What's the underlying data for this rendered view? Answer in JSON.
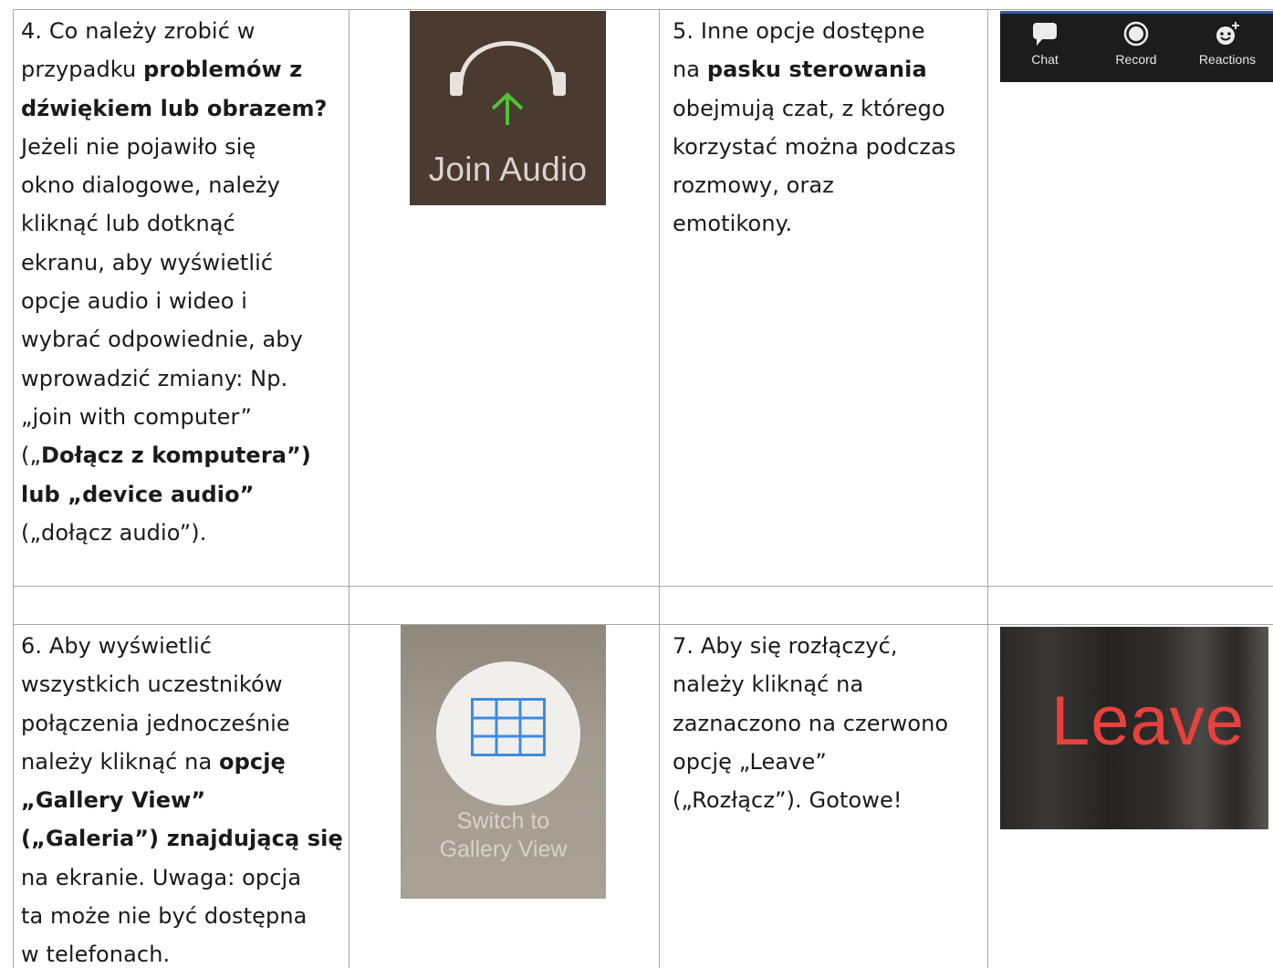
{
  "cell4": {
    "lines": [
      [
        {
          "t": "4. Co należy zrobić w",
          "b": false
        }
      ],
      [
        {
          "t": "przypadku ",
          "b": false
        },
        {
          "t": "problemów z",
          "b": true
        }
      ],
      [
        {
          "t": "dźwiękiem lub obrazem?",
          "b": true
        }
      ],
      [
        {
          "t": "Jeżeli nie pojawiło się",
          "b": false
        }
      ],
      [
        {
          "t": "okno dialogowe, należy",
          "b": false
        }
      ],
      [
        {
          "t": "kliknąć lub dotknąć",
          "b": false
        }
      ],
      [
        {
          "t": "ekranu, aby wyświetlić",
          "b": false
        }
      ],
      [
        {
          "t": "opcje audio i wideo i",
          "b": false
        }
      ],
      [
        {
          "t": "wybrać odpowiednie, aby",
          "b": false
        }
      ],
      [
        {
          "t": "wprowadzić zmiany: Np.",
          "b": false
        }
      ],
      [
        {
          "t": "„join with computer”",
          "b": false
        }
      ],
      [
        {
          "t": "(„",
          "b": false
        },
        {
          "t": "Dołącz z komputera”)",
          "b": true
        }
      ],
      [
        {
          "t": "lub „device audio”",
          "b": true
        }
      ],
      [
        {
          "t": "(„dołącz audio”).",
          "b": false
        }
      ]
    ]
  },
  "cell5": {
    "lines": [
      [
        {
          "t": "5. Inne opcje dostępne",
          "b": false
        }
      ],
      [
        {
          "t": "na ",
          "b": false
        },
        {
          "t": "pasku sterowania",
          "b": true
        }
      ],
      [
        {
          "t": "obejmują czat, z którego",
          "b": false
        }
      ],
      [
        {
          "t": "korzystać można podczas",
          "b": false
        }
      ],
      [
        {
          "t": "rozmowy, oraz",
          "b": false
        }
      ],
      [
        {
          "t": "emotikony.",
          "b": false
        }
      ]
    ]
  },
  "cell6": {
    "lines": [
      [
        {
          "t": "6. Aby wyświetlić",
          "b": false
        }
      ],
      [
        {
          "t": "wszystkich uczestników",
          "b": false
        }
      ],
      [
        {
          "t": "połączenia jednocześnie",
          "b": false
        }
      ],
      [
        {
          "t": "należy kliknąć na ",
          "b": false
        },
        {
          "t": "opcję",
          "b": true
        }
      ],
      [
        {
          "t": "„Gallery View”",
          "b": true
        }
      ],
      [
        {
          "t": "(„Galeria”) znajdującą się",
          "b": true
        }
      ],
      [
        {
          "t": "na ekranie. Uwaga: opcja",
          "b": false
        }
      ],
      [
        {
          "t": "ta może nie być dostępna",
          "b": false
        }
      ],
      [
        {
          "t": "w telefonach.",
          "b": false
        }
      ]
    ]
  },
  "cell7": {
    "lines": [
      [
        {
          "t": "7. Aby się rozłączyć,",
          "b": false
        }
      ],
      [
        {
          "t": "należy kliknąć na",
          "b": false
        }
      ],
      [
        {
          "t": "zaznaczono na czerwono",
          "b": false
        }
      ],
      [
        {
          "t": "opcję „Leave”",
          "b": false
        }
      ],
      [
        {
          "t": "(„Rozłącz”).  Gotowe!",
          "b": false
        }
      ]
    ]
  },
  "images": {
    "join_audio_label": "Join Audio",
    "controlbar": {
      "chat_label": "Chat",
      "record_label": "Record",
      "reactions_label": "Reactions"
    },
    "gallery_line1": "Switch to",
    "gallery_line2": "Gallery View",
    "leave_label": "Leave"
  }
}
